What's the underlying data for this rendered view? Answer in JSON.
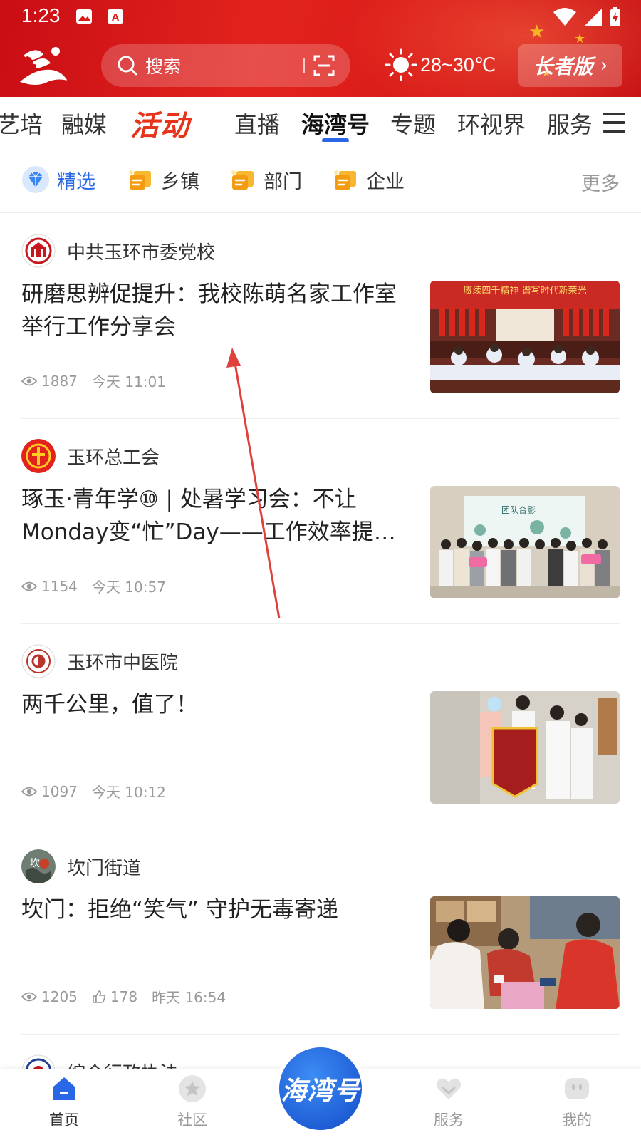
{
  "status_bar": {
    "time": "1:23"
  },
  "header": {
    "search_placeholder": "搜索",
    "weather_temp": "28~30℃",
    "elder_label": "长者版",
    "elder_chevron": "›",
    "colors": {
      "primary_red": "#d81a18",
      "accent_blue": "#2a67e6"
    }
  },
  "tabs": {
    "items": [
      "艺培",
      "融媒",
      "活动",
      "直播",
      "海湾号",
      "专题",
      "环视界",
      "服务"
    ],
    "active": "海湾号"
  },
  "subcats": {
    "items": [
      "精选",
      "乡镇",
      "部门",
      "企业"
    ],
    "active": "精选",
    "more": "更多"
  },
  "feed": [
    {
      "source": "中共玉环市委党校",
      "title": "研磨思辨促提升：我校陈萌名家工作室举行工作分享会",
      "views": "1887",
      "time": "今天 11:01",
      "banner_text": "赓续四千精神 谱写时代新荣光"
    },
    {
      "source": "玉环总工会",
      "title": "琢玉·青年学⑩ | 处暑学习会：不让Monday变“忙”Day——工作效率提升技巧",
      "views": "1154",
      "time": "今天 10:57",
      "banner_text": "团队合影"
    },
    {
      "source": "玉环市中医院",
      "title": "两千公里，值了！",
      "views": "1097",
      "time": "今天 10:12"
    },
    {
      "source": "坎门街道",
      "title": "坎门：拒绝“笑气” 守护无毒寄递",
      "views": "1205",
      "likes": "178",
      "time": "昨天 16:54"
    },
    {
      "source": "综合行政执法"
    }
  ],
  "bottom_nav": {
    "items": [
      "首页",
      "社区",
      "服务",
      "我的"
    ],
    "center": "海湾号",
    "active": "首页"
  }
}
